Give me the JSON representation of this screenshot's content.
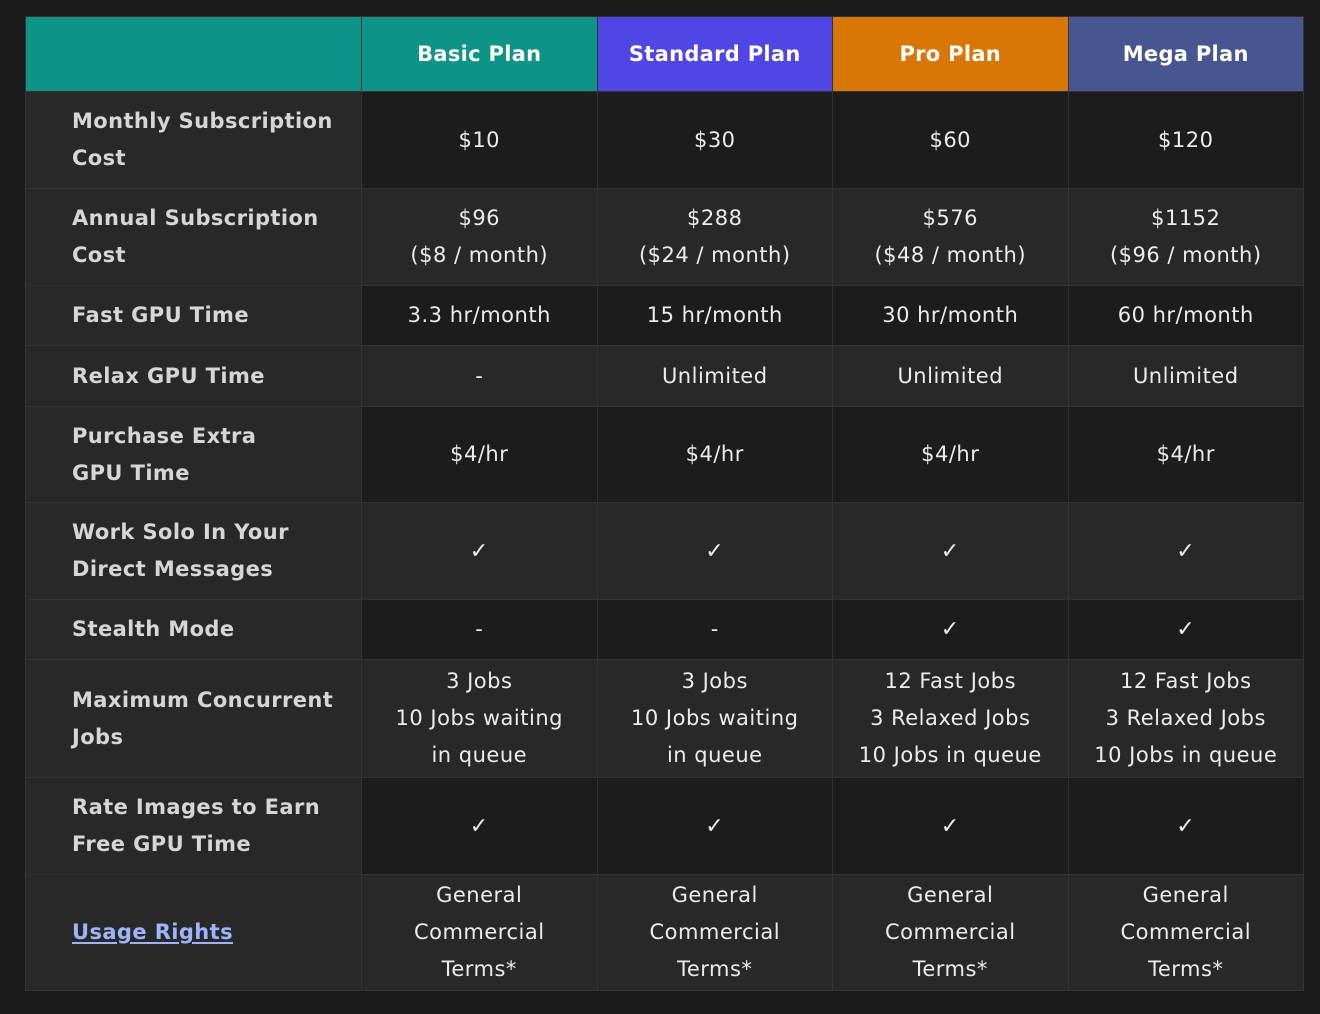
{
  "colors": {
    "basic_header": "#0e9486",
    "standard_header": "#4f46e5",
    "pro_header": "#d97706",
    "mega_header": "#475691",
    "link": "#9fb4ff"
  },
  "plans": [
    {
      "name": "Basic Plan",
      "color": "#0e9486"
    },
    {
      "name": "Standard Plan",
      "color": "#4f46e5"
    },
    {
      "name": "Pro Plan",
      "color": "#d97706"
    },
    {
      "name": "Mega Plan",
      "color": "#475691"
    }
  ],
  "rows": [
    {
      "key": "monthly-subscription-cost",
      "label": [
        "Monthly Subscription",
        "Cost"
      ],
      "cells": [
        [
          "$10"
        ],
        [
          "$30"
        ],
        [
          "$60"
        ],
        [
          "$120"
        ]
      ]
    },
    {
      "key": "annual-subscription-cost",
      "label": [
        "Annual Subscription",
        "Cost"
      ],
      "cells": [
        [
          "$96",
          "($8 / month)"
        ],
        [
          "$288",
          "($24 / month)"
        ],
        [
          "$576",
          "($48 / month)"
        ],
        [
          "$1152",
          "($96 / month)"
        ]
      ]
    },
    {
      "key": "fast-gpu-time",
      "label": [
        "Fast GPU Time"
      ],
      "cells": [
        [
          "3.3 hr/month"
        ],
        [
          "15 hr/month"
        ],
        [
          "30 hr/month"
        ],
        [
          "60 hr/month"
        ]
      ]
    },
    {
      "key": "relax-gpu-time",
      "label": [
        "Relax GPU Time"
      ],
      "cells": [
        [
          "-"
        ],
        [
          "Unlimited"
        ],
        [
          "Unlimited"
        ],
        [
          "Unlimited"
        ]
      ]
    },
    {
      "key": "purchase-extra-gpu-time",
      "label": [
        "Purchase Extra",
        "GPU Time"
      ],
      "cells": [
        [
          "$4/hr"
        ],
        [
          "$4/hr"
        ],
        [
          "$4/hr"
        ],
        [
          "$4/hr"
        ]
      ]
    },
    {
      "key": "work-solo-direct-messages",
      "label": [
        "Work Solo In Your",
        "Direct Messages"
      ],
      "cells": [
        [
          "✓"
        ],
        [
          "✓"
        ],
        [
          "✓"
        ],
        [
          "✓"
        ]
      ]
    },
    {
      "key": "stealth-mode",
      "label": [
        "Stealth Mode"
      ],
      "cells": [
        [
          "-"
        ],
        [
          "-"
        ],
        [
          "✓"
        ],
        [
          "✓"
        ]
      ]
    },
    {
      "key": "maximum-concurrent-jobs",
      "label": [
        "Maximum Concurrent",
        "Jobs"
      ],
      "cells": [
        [
          "3 Jobs",
          "10 Jobs waiting",
          "in queue"
        ],
        [
          "3 Jobs",
          "10 Jobs waiting",
          "in queue"
        ],
        [
          "12 Fast Jobs",
          "3 Relaxed Jobs",
          "10 Jobs in queue"
        ],
        [
          "12 Fast Jobs",
          "3 Relaxed Jobs",
          "10 Jobs in queue"
        ]
      ]
    },
    {
      "key": "rate-images-earn-gpu-time",
      "label": [
        "Rate Images to Earn",
        "Free GPU Time"
      ],
      "cells": [
        [
          "✓"
        ],
        [
          "✓"
        ],
        [
          "✓"
        ],
        [
          "✓"
        ]
      ]
    },
    {
      "key": "usage-rights",
      "label": [
        "Usage Rights"
      ],
      "label_is_link": true,
      "cells": [
        [
          "General",
          "Commercial",
          "Terms*"
        ],
        [
          "General",
          "Commercial",
          "Terms*"
        ],
        [
          "General",
          "Commercial",
          "Terms*"
        ],
        [
          "General",
          "Commercial",
          "Terms*"
        ]
      ]
    }
  ]
}
